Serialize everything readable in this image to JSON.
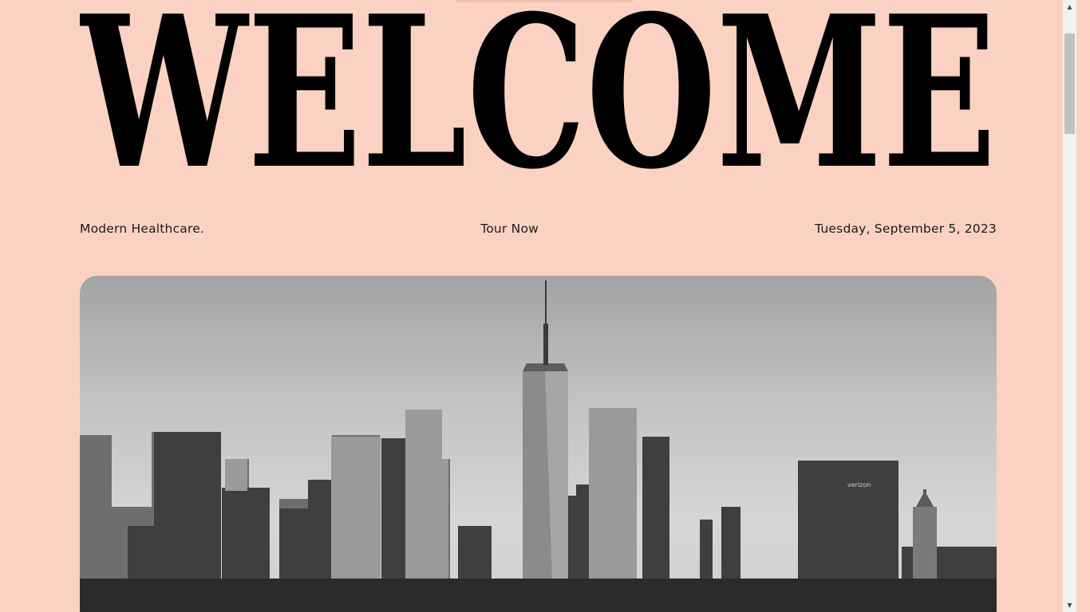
{
  "header": {
    "title": "WELCOME"
  },
  "meta": {
    "tagline": "Modern Healthcare.",
    "cta_label": "Tour Now",
    "date": "Tuesday, September 5, 2023"
  },
  "hero": {
    "image": "city-skyline-photo",
    "sign_text": "verizon"
  },
  "scrollbar": {
    "up_icon": "scroll-up-arrow-icon",
    "down_icon": "scroll-down-arrow-icon"
  },
  "colors": {
    "background": "#FBD2C1",
    "text": "#1a1a1a",
    "wordmark": "#000000"
  }
}
